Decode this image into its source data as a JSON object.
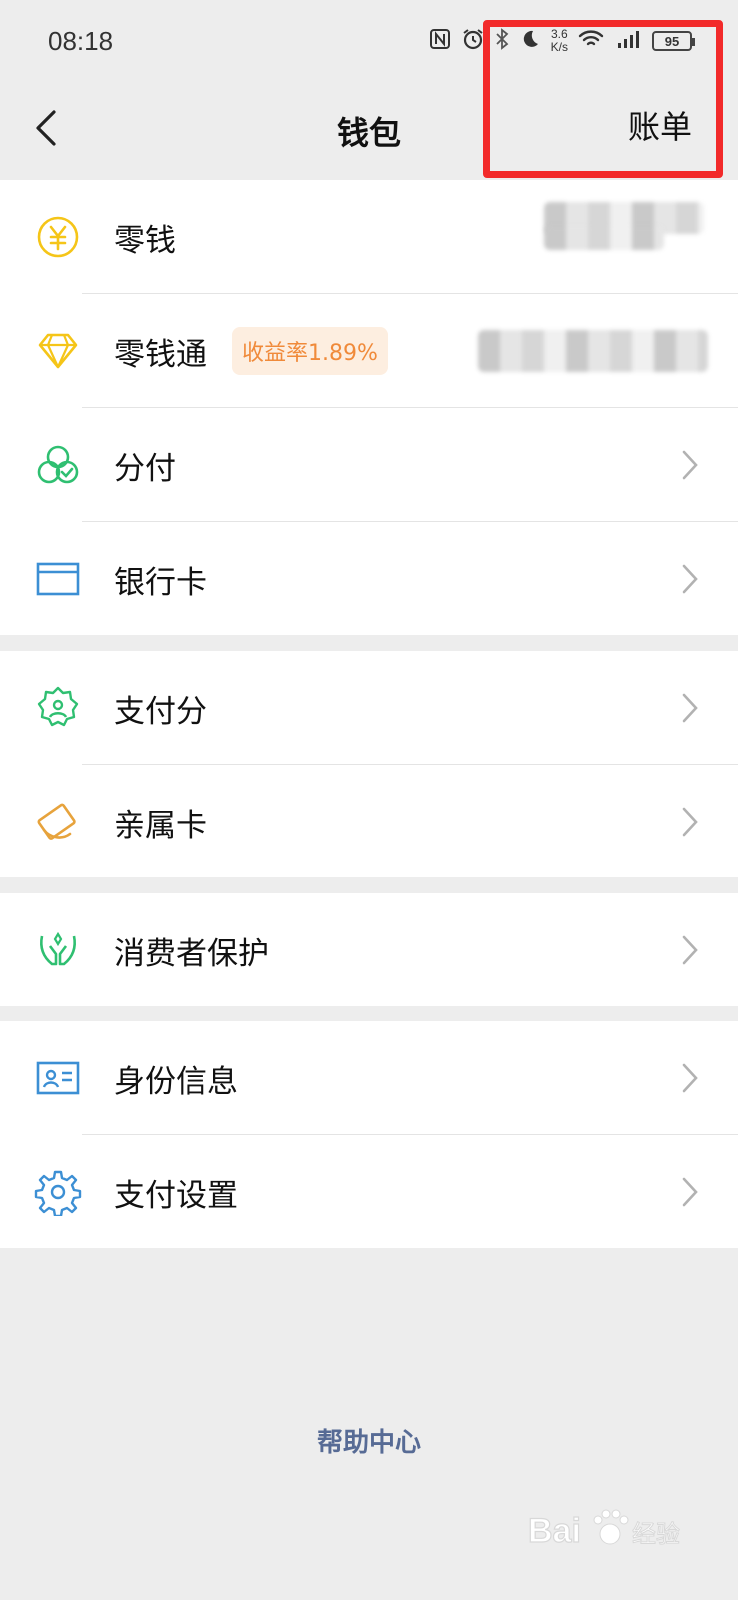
{
  "status_bar": {
    "time": "08:18",
    "net_speed_value": "3.6",
    "net_speed_unit": "K/s",
    "battery": "95"
  },
  "nav": {
    "title": "钱包",
    "bill": "账单"
  },
  "groups": [
    {
      "items": [
        {
          "label": "零钱",
          "icon": "yuan-coin-icon"
        },
        {
          "label": "零钱通",
          "icon": "diamond-icon",
          "badge": "收益率1.89%"
        },
        {
          "label": "分付",
          "icon": "fenfu-icon"
        },
        {
          "label": "银行卡",
          "icon": "bank-card-icon"
        }
      ]
    },
    {
      "items": [
        {
          "label": "支付分",
          "icon": "payscore-badge-icon"
        },
        {
          "label": "亲属卡",
          "icon": "family-card-icon"
        }
      ]
    },
    {
      "items": [
        {
          "label": "消费者保护",
          "icon": "protect-hands-icon"
        }
      ]
    },
    {
      "items": [
        {
          "label": "身份信息",
          "icon": "id-card-icon"
        },
        {
          "label": "支付设置",
          "icon": "gear-icon"
        }
      ]
    }
  ],
  "help_center": "帮助中心",
  "watermark": "Bai du 经验",
  "colors": {
    "accent_link": "#576b95",
    "highlight_box": "#f22a2a",
    "badge_text": "#f08a3a",
    "badge_bg": "#fdeee0",
    "page_bg": "#ededed"
  }
}
